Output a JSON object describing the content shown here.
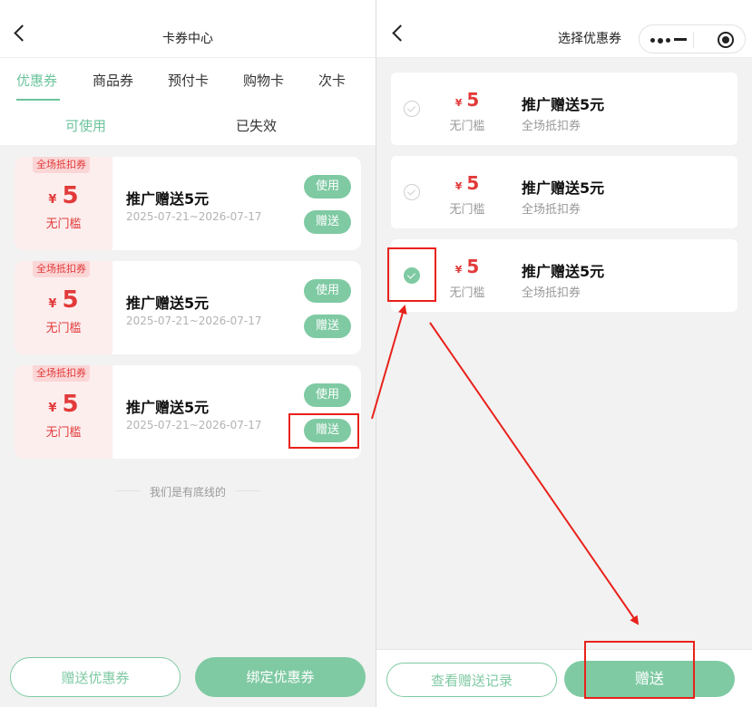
{
  "colors": {
    "accent": "#7fcaa3",
    "price": "#e23a3a",
    "annotation": "#e8221b"
  },
  "left": {
    "title": "卡券中心",
    "tabs": [
      "优惠券",
      "商品券",
      "预付卡",
      "购物卡",
      "次卡"
    ],
    "active_tab": "优惠券",
    "subtabs": [
      "可使用",
      "已失效"
    ],
    "active_subtab": "可使用",
    "coupons": [
      {
        "badge": "全场抵扣券",
        "currency": "¥",
        "amount": "5",
        "threshold": "无门槛",
        "title": "推广赠送5元",
        "date": "2025-07-21~2026-07-17",
        "use_label": "使用",
        "gift_label": "赠送"
      },
      {
        "badge": "全场抵扣券",
        "currency": "¥",
        "amount": "5",
        "threshold": "无门槛",
        "title": "推广赠送5元",
        "date": "2025-07-21~2026-07-17",
        "use_label": "使用",
        "gift_label": "赠送"
      },
      {
        "badge": "全场抵扣券",
        "currency": "¥",
        "amount": "5",
        "threshold": "无门槛",
        "title": "推广赠送5元",
        "date": "2025-07-21~2026-07-17",
        "use_label": "使用",
        "gift_label": "赠送"
      }
    ],
    "end_text": "我们是有底线的",
    "footer": {
      "gift_button": "赠送优惠券",
      "bind_button": "绑定优惠券"
    }
  },
  "right": {
    "title": "选择优惠券",
    "capsule_icons": [
      "more-dots-icon",
      "minimize-icon",
      "close-target-icon"
    ],
    "coupons": [
      {
        "currency": "¥",
        "amount": "5",
        "threshold": "无门槛",
        "title": "推广赠送5元",
        "subtitle": "全场抵扣券",
        "selected": false
      },
      {
        "currency": "¥",
        "amount": "5",
        "threshold": "无门槛",
        "title": "推广赠送5元",
        "subtitle": "全场抵扣券",
        "selected": false
      },
      {
        "currency": "¥",
        "amount": "5",
        "threshold": "无门槛",
        "title": "推广赠送5元",
        "subtitle": "全场抵扣券",
        "selected": true
      }
    ],
    "footer": {
      "record_button": "查看赠送记录",
      "gift_button": "赠送"
    }
  }
}
